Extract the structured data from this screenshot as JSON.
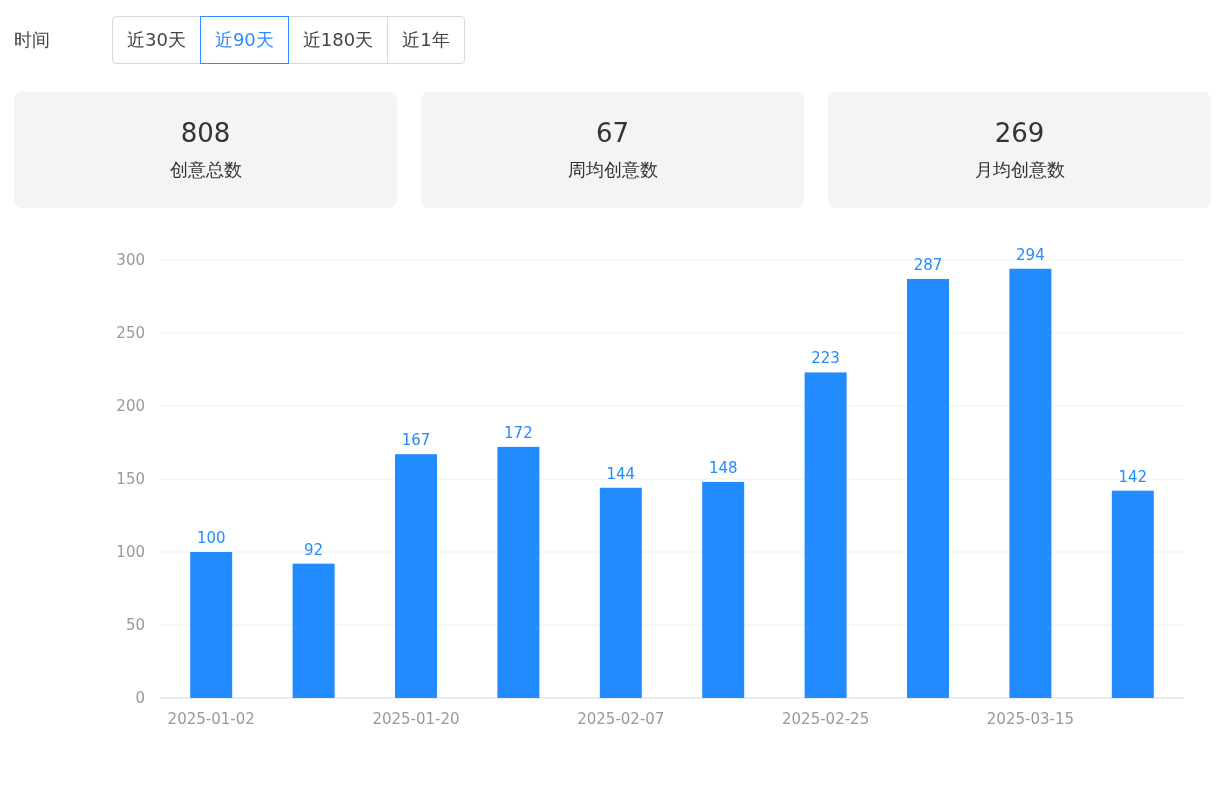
{
  "filter": {
    "label": "时间",
    "options": [
      {
        "label": "近30天",
        "selected": false
      },
      {
        "label": "近90天",
        "selected": true
      },
      {
        "label": "近180天",
        "selected": false
      },
      {
        "label": "近1年",
        "selected": false
      }
    ]
  },
  "stats": [
    {
      "value": "808",
      "label": "创意总数"
    },
    {
      "value": "67",
      "label": "周均创意数"
    },
    {
      "value": "269",
      "label": "月均创意数"
    }
  ],
  "chart": {
    "chart_data": {
      "type": "bar",
      "categories": [
        "2025-01-02",
        null,
        "2025-01-20",
        null,
        "2025-02-07",
        null,
        "2025-02-25",
        null,
        "2025-03-15",
        null
      ],
      "series": [
        {
          "color": "#228bff",
          "values": [
            100,
            92,
            167,
            172,
            144,
            148,
            223,
            287,
            294,
            142
          ]
        }
      ],
      "grid": true,
      "ylim": [
        0,
        300
      ],
      "yticks": [
        0,
        50,
        100,
        150,
        200,
        250,
        300
      ],
      "data_labels": true
    }
  }
}
